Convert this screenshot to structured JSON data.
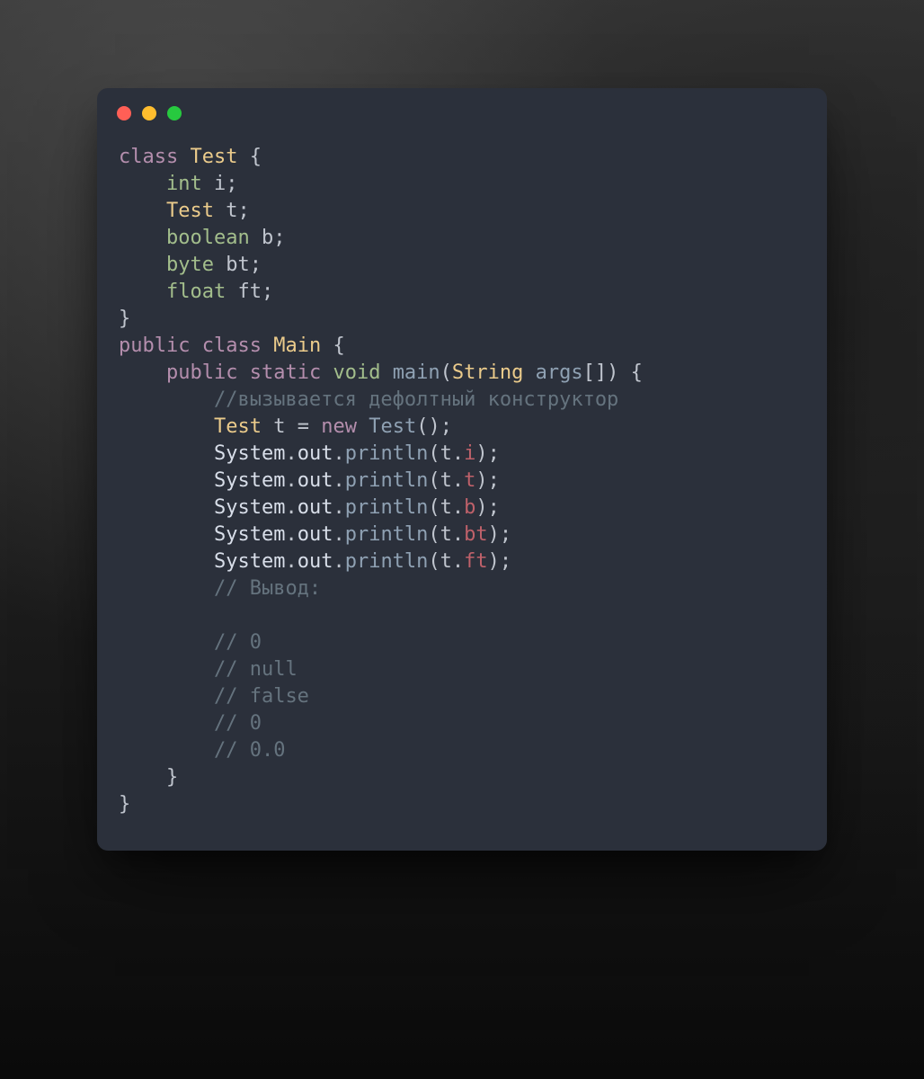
{
  "window": {
    "traffic_lights": {
      "red": "#ff5f56",
      "yellow": "#ffbd2e",
      "green": "#27c93f"
    }
  },
  "tok": {
    "kw_class": "class",
    "kw_public": "public",
    "kw_static": "static",
    "kw_void": "void",
    "kw_new": "new",
    "type_int": "int",
    "type_boolean": "boolean",
    "type_byte": "byte",
    "type_float": "float",
    "type_Test": "Test",
    "type_Main": "Main",
    "type_String": "String",
    "method_main": "main",
    "id_i": "i",
    "id_t": "t",
    "id_b": "b",
    "id_bt": "bt",
    "id_ft": "ft",
    "id_args": "args",
    "id_System": "System",
    "id_out": "out",
    "id_println": "println",
    "comment_ctor": "//вызывается дефолтный конструктор",
    "comment_output_label": "// Вывод:",
    "comment_0a": "// 0",
    "comment_null": "// null",
    "comment_false": "// false",
    "comment_0b": "// 0",
    "comment_0_0": "// 0.0",
    "brace_open": "{",
    "brace_close": "}",
    "paren_open": "(",
    "paren_close": ")",
    "brackets": "[]",
    "semi": ";",
    "dot": ".",
    "eq": "="
  }
}
